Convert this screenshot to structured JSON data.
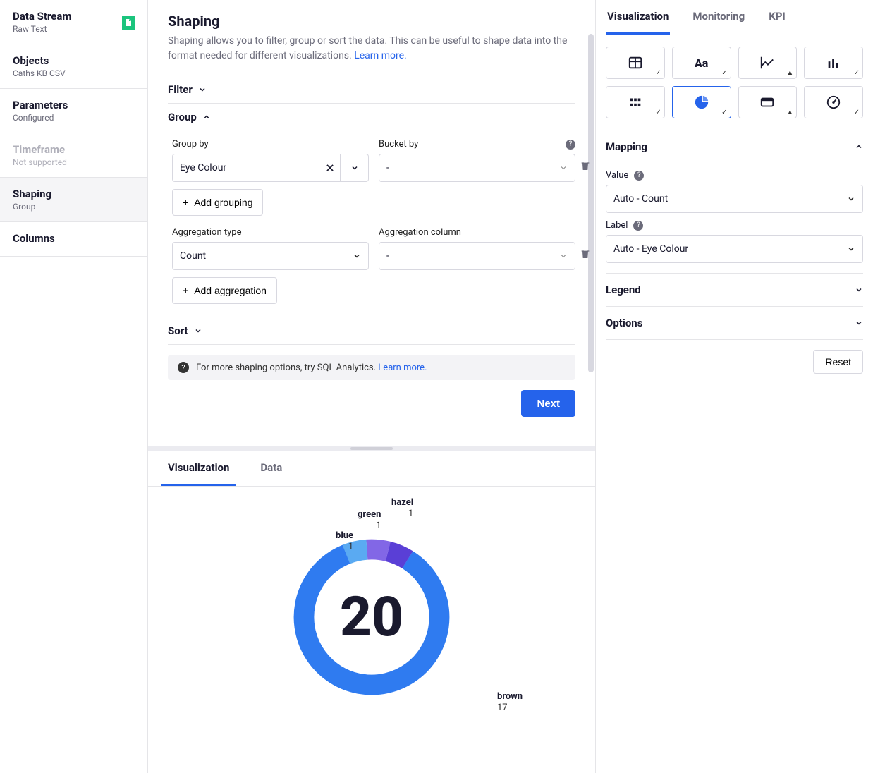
{
  "sidebar": {
    "items": [
      {
        "title": "Data Stream",
        "sub": "Raw Text",
        "badge": true
      },
      {
        "title": "Objects",
        "sub": "Caths KB CSV"
      },
      {
        "title": "Parameters",
        "sub": "Configured"
      },
      {
        "title": "Timeframe",
        "sub": "Not supported",
        "disabled": true
      },
      {
        "title": "Shaping",
        "sub": "Group",
        "active": true
      },
      {
        "title": "Columns",
        "sub": ""
      }
    ]
  },
  "main": {
    "heading": "Shaping",
    "desc": "Shaping allows you to filter, group or sort the data. This can be useful to shape data into the format needed for different visualizations. ",
    "learn_more": "Learn more.",
    "filter_label": "Filter",
    "group_label": "Group",
    "group_by_label": "Group by",
    "group_by_value": "Eye Colour",
    "bucket_by_label": "Bucket by",
    "bucket_by_value": "-",
    "add_grouping": "Add grouping",
    "agg_type_label": "Aggregation type",
    "agg_type_value": "Count",
    "agg_col_label": "Aggregation column",
    "agg_col_value": "-",
    "add_aggregation": "Add aggregation",
    "sort_label": "Sort",
    "info_text": "For more shaping options, try SQL Analytics. ",
    "info_link": "Learn more.",
    "next": "Next"
  },
  "bottom": {
    "tabs": [
      "Visualization",
      "Data"
    ],
    "total": "20"
  },
  "chart_data": {
    "type": "pie",
    "title": "",
    "total": 20,
    "series": [
      {
        "name": "brown",
        "value": 17,
        "color": "#2f7bf0"
      },
      {
        "name": "hazel",
        "value": 1,
        "color": "#5a3fd6"
      },
      {
        "name": "green",
        "value": 1,
        "color": "#8267e6"
      },
      {
        "name": "blue",
        "value": 1,
        "color": "#5aaaf2"
      }
    ],
    "labels": {
      "brown": "brown",
      "brown_n": "17",
      "hazel": "hazel",
      "hazel_n": "1",
      "green": "green",
      "green_n": "1",
      "blue": "blue",
      "blue_n": "1"
    }
  },
  "right": {
    "tabs": [
      "Visualization",
      "Monitoring",
      "KPI"
    ],
    "mapping_label": "Mapping",
    "value_label": "Value",
    "value_sel": "Auto - Count",
    "label_label": "Label",
    "label_sel": "Auto - Eye Colour",
    "legend_label": "Legend",
    "options_label": "Options",
    "reset": "Reset"
  }
}
